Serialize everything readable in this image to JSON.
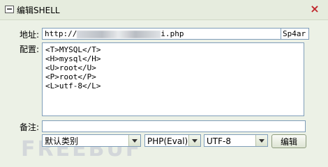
{
  "window": {
    "title": "编辑SHELL",
    "close_symbol": "×"
  },
  "form": {
    "address_label": "地址:",
    "address_prefix": "http://",
    "address_suffix": "i.php",
    "address_tail": "Sp4ar",
    "config_label": "配置:",
    "config_lines": [
      "<T>MYSQL</T>",
      "<H>mysql</H>",
      "<U>root</U>",
      "<P>root</P>",
      "<L>utf-8</L>"
    ],
    "note_label": "备注:",
    "note_value": ""
  },
  "footer": {
    "category_value": "默认类别",
    "type_value": "PHP(Eval)",
    "encoding_value": "UTF-8",
    "edit_label": "编辑"
  },
  "watermark": "FREEBUF"
}
